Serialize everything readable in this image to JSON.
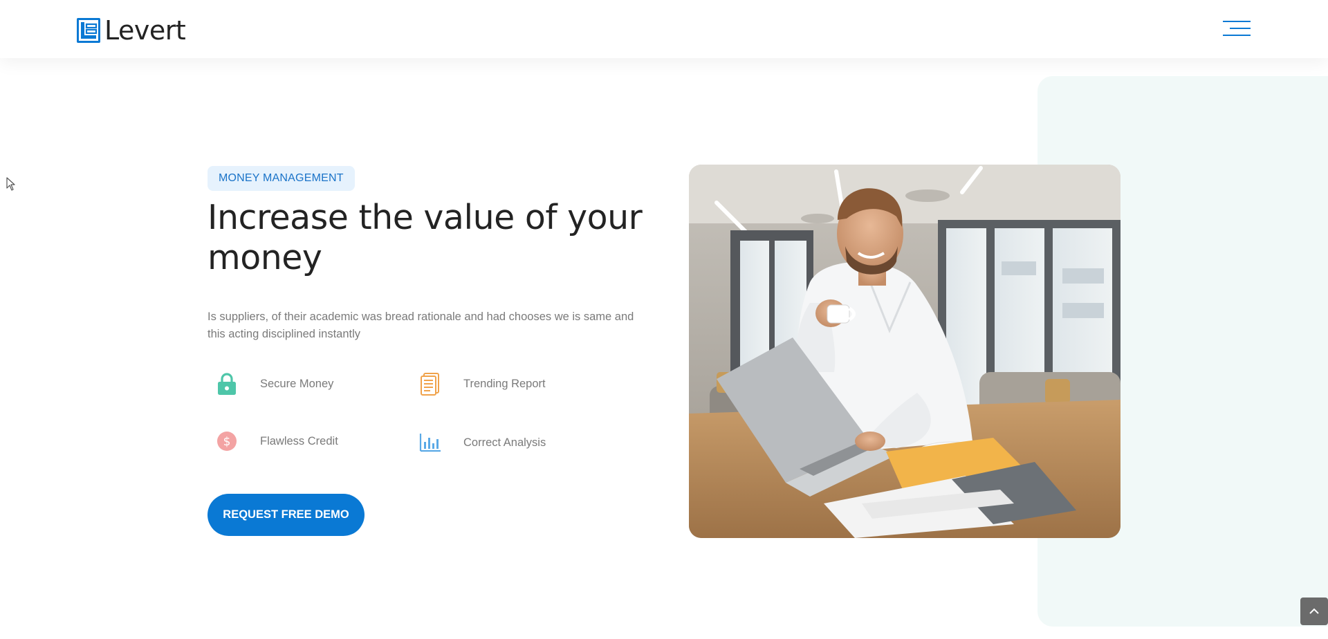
{
  "header": {
    "brand": "Levert",
    "icons": {
      "logo": "levert-logo-icon",
      "menu": "hamburger-menu-icon"
    },
    "colors": {
      "brand": "#0a79d4"
    }
  },
  "hero": {
    "badge": "MONEY MANAGEMENT",
    "title": "Increase the value of your money",
    "description": "Is suppliers, of their academic was bread rationale and had chooses we is same and this acting disciplined instantly",
    "features": [
      {
        "label": "Secure Money",
        "icon": "lock-icon",
        "color": "#4ec6a9"
      },
      {
        "label": "Trending Report",
        "icon": "document-icon",
        "color": "#f0a24a"
      },
      {
        "label": "Flawless Credit",
        "icon": "dollar-coin-icon",
        "color": "#f3a3a3"
      },
      {
        "label": "Correct Analysis",
        "icon": "bar-chart-icon",
        "color": "#5aa9e6"
      }
    ],
    "cta": "REQUEST FREE DEMO",
    "photo_icon": "man-with-coffee-at-laptop-photo"
  },
  "ui": {
    "scroll_top_icon": "chevron-up-icon"
  }
}
